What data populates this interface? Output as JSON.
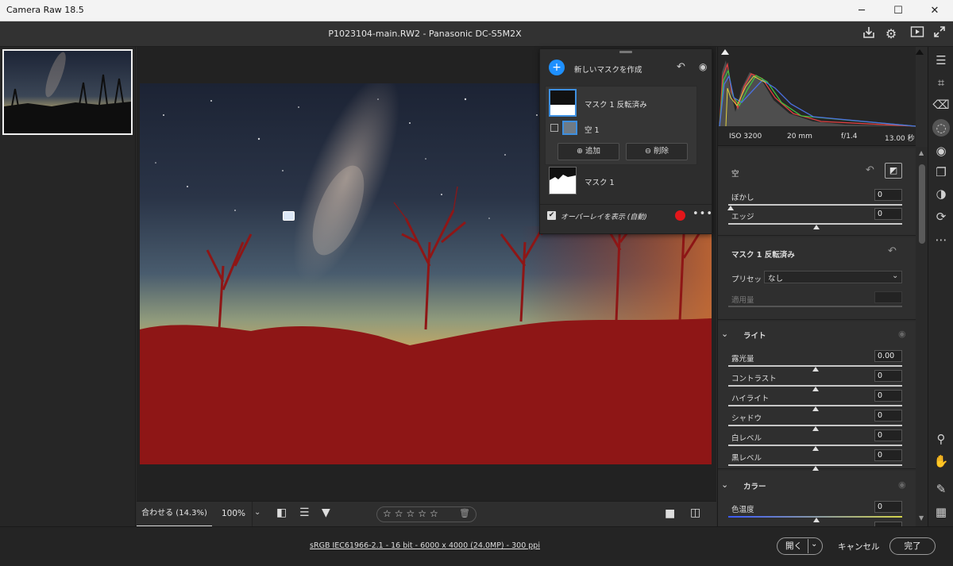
{
  "window": {
    "title": "Camera Raw 18.5",
    "minimize": "─",
    "maximize": "☐",
    "close": "✕"
  },
  "header": {
    "file_title": "P1023104-main.RW2  -  Panasonic DC-S5M2X"
  },
  "mask_panel": {
    "create_label": "新しいマスクを作成",
    "mask_group_1": "マスク 1 反転済み",
    "component": "空 1",
    "add_label": "追加",
    "subtract_label": "削除",
    "mask_group_2": "マスク 1",
    "overlay_label": "オーバーレイを表示 (自動)",
    "overlay_checked": true,
    "overlay_color": "#e3161a"
  },
  "view_bar": {
    "fit_label": "合わせる (14.3%)",
    "zoom_label": "100%",
    "rating_stars": 5
  },
  "histogram": {
    "iso": "ISO 3200",
    "focal": "20 mm",
    "aperture": "f/1.4",
    "shutter": "13.00 秒"
  },
  "sky_section": {
    "title": "空",
    "sliders": [
      {
        "label": "ぼかし",
        "value": "0"
      },
      {
        "label": "エッジ",
        "value": "0"
      }
    ]
  },
  "mask_section": {
    "title": "マスク 1 反転済み",
    "preset_label": "プリセット",
    "preset_value": "なし",
    "amount_label": "適用量"
  },
  "light_section": {
    "title": "ライト",
    "sliders": [
      {
        "label": "露光量",
        "value": "0.00"
      },
      {
        "label": "コントラスト",
        "value": "0"
      },
      {
        "label": "ハイライト",
        "value": "0"
      },
      {
        "label": "シャドウ",
        "value": "0"
      },
      {
        "label": "白レベル",
        "value": "0"
      },
      {
        "label": "黒レベル",
        "value": "0"
      }
    ]
  },
  "color_section": {
    "title": "カラー",
    "sliders": [
      {
        "label": "色温度",
        "value": "0"
      }
    ]
  },
  "footer": {
    "info_link": "sRGB IEC61966-2.1 - 16 bit - 6000 x 4000 (24.0MP) - 300 ppi",
    "open_label": "開く",
    "cancel_label": "キャンセル",
    "done_label": "完了"
  },
  "colors": {
    "accent_blue": "#1e90ff",
    "overlay_red": "#8e1616"
  }
}
